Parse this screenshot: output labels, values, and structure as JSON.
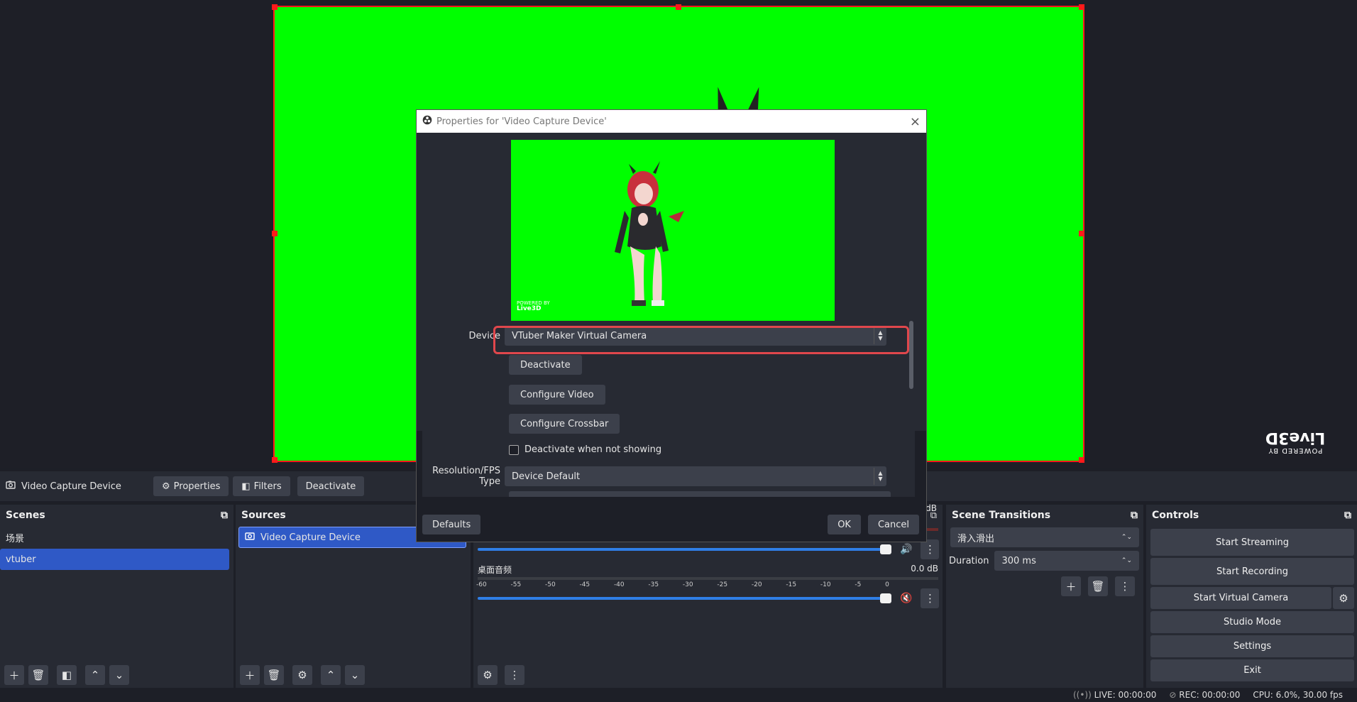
{
  "dialog": {
    "title": "Properties for 'Video Capture Device'",
    "device_label": "Device",
    "device_value": "VTuber Maker Virtual Camera",
    "deactivate_label": "Deactivate",
    "configure_video_label": "Configure Video",
    "configure_crossbar_label": "Configure Crossbar",
    "deactivate_when_not_showing_label": "Deactivate when not showing",
    "resolution_label": "Resolution/FPS Type",
    "resolution_value": "Device Default",
    "defaults_label": "Defaults",
    "ok_label": "OK",
    "cancel_label": "Cancel"
  },
  "source_toolbar": {
    "source_name": "Video Capture Device",
    "properties_label": "Properties",
    "filters_label": "Filters",
    "deactivate_label": "Deactivate"
  },
  "scenes": {
    "title": "Scenes",
    "items": [
      {
        "label": "场景",
        "selected": false
      },
      {
        "label": "vtuber",
        "selected": true
      }
    ]
  },
  "sources": {
    "title": "Sources",
    "items": [
      {
        "label": "Video Capture Device",
        "selected": true
      }
    ]
  },
  "mixer": {
    "partial_db": "dB",
    "channel2_name": "桌面音频",
    "channel2_db": "0.0 dB",
    "scale": [
      "-60",
      "-55",
      "-50",
      "-45",
      "-40",
      "-35",
      "-30",
      "-25",
      "-20",
      "-15",
      "-10",
      "-5",
      "0"
    ]
  },
  "transitions": {
    "title": "Scene Transitions",
    "current": "滑入滑出",
    "duration_label": "Duration",
    "duration_value": "300 ms"
  },
  "controls": {
    "title": "Controls",
    "start_streaming": "Start Streaming",
    "start_recording": "Start Recording",
    "start_virtual_camera": "Start Virtual Camera",
    "studio_mode": "Studio Mode",
    "settings": "Settings",
    "exit": "Exit"
  },
  "status": {
    "live": "LIVE: 00:00:00",
    "rec": "REC: 00:00:00",
    "cpu": "CPU: 6.0%, 30.00 fps"
  },
  "watermark": {
    "powered_by": "POWERED BY",
    "brand": "Live3D"
  },
  "colors": {
    "chroma_green": "#00ff00",
    "selection_blue": "#2f59c6",
    "highlight_red": "#e0474c",
    "fader_blue": "#2f7ee6"
  }
}
